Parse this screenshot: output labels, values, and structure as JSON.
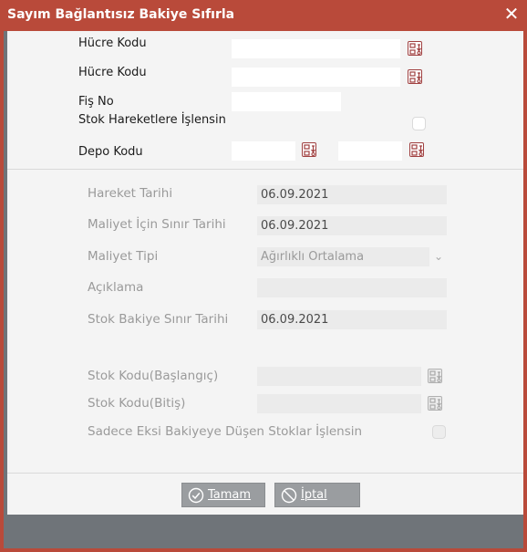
{
  "window": {
    "title": "Sayım Bağlantısız Bakiye Sıfırla",
    "close_icon": "close-icon"
  },
  "top": {
    "hucre_kodu_1_label": "Hücre Kodu",
    "hucre_kodu_1_value": "",
    "hucre_kodu_2_label": "Hücre Kodu",
    "hucre_kodu_2_value": "",
    "fis_no_label": "Fiş No",
    "fis_no_value": "",
    "stok_hareket_label": "Stok Hareketlere İşlensin",
    "stok_hareket_checked": false,
    "depo_kodu_label": "Depo Kodu",
    "depo_kodu_1_value": "",
    "depo_kodu_2_value": ""
  },
  "params": {
    "hareket_tarihi_label": "Hareket Tarihi",
    "hareket_tarihi_value": "06.09.2021",
    "maliyet_sinir_label": "Maliyet İçin Sınır Tarihi",
    "maliyet_sinir_value": "06.09.2021",
    "maliyet_tipi_label": "Maliyet Tipi",
    "maliyet_tipi_value": "Ağırlıklı Ortalama",
    "aciklama_label": "Açıklama",
    "aciklama_value": "",
    "stok_bakiye_label": "Stok Bakiye Sınır Tarihi",
    "stok_bakiye_value": "06.09.2021",
    "stok_kodu_bas_label": "Stok Kodu(Başlangıç)",
    "stok_kodu_bas_value": "",
    "stok_kodu_bit_label": "Stok Kodu(Bitiş)",
    "stok_kodu_bit_value": "",
    "sadece_eksi_label": "Sadece Eksi Bakiyeye Düşen Stoklar İşlensin",
    "sadece_eksi_checked": false
  },
  "buttons": {
    "ok_label": "Tamam",
    "cancel_label": "İptal"
  },
  "colors": {
    "accent": "#b94a3a",
    "lookup_border": "#a04040",
    "dialog_bg": "#f4f4f4",
    "frame": "#6f7479"
  }
}
